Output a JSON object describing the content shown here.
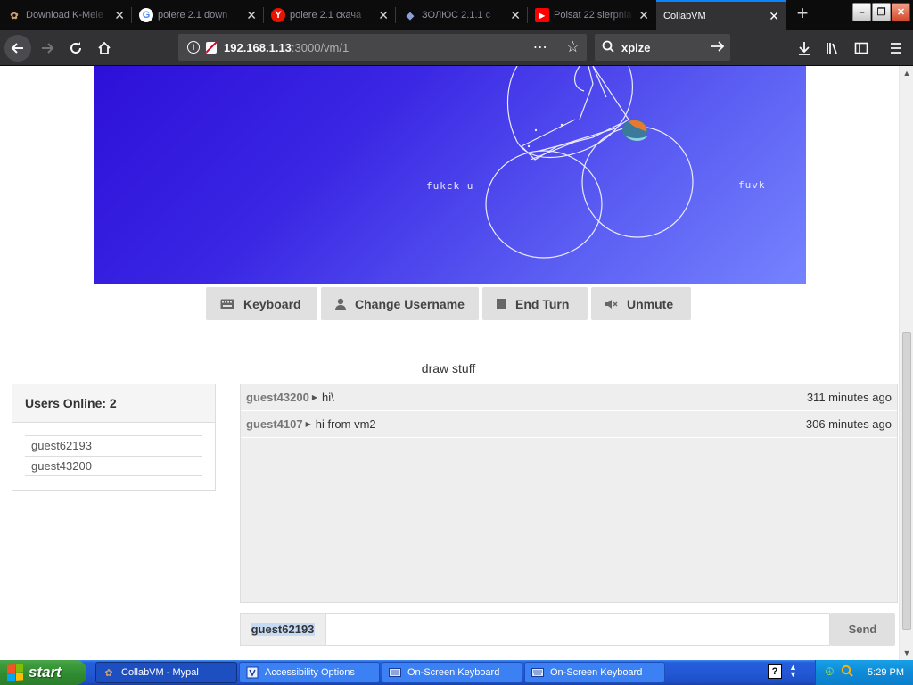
{
  "browser": {
    "tabs": [
      {
        "title": "Download K-Mele",
        "favicon": "kmeleon-icon"
      },
      {
        "title": "polere 2.1 down",
        "favicon": "google-icon"
      },
      {
        "title": "polere 2.1 скача",
        "favicon": "yandex-icon"
      },
      {
        "title": "ЗОЛЮС 2.1.1 с",
        "favicon": "diamond-site-icon"
      },
      {
        "title": "Polsat 22 sierpnia",
        "favicon": "youtube-icon"
      },
      {
        "title": "CollabVM",
        "favicon": "none",
        "active": true
      }
    ],
    "url_host": "192.168.1.13",
    "url_path": ":3000/vm/1",
    "search_text": "xpize",
    "colors": {
      "tab_accent": "#0a84ff",
      "toolbar": "#323234",
      "tabstrip": "#0c0c0d"
    }
  },
  "vm": {
    "screen_texts": [
      "fukck u",
      "fuvk"
    ],
    "buttons": {
      "keyboard": "Keyboard",
      "change_username": "Change Username",
      "end_turn": "End Turn",
      "unmute": "Unmute"
    },
    "motd": "draw stuff"
  },
  "users": {
    "header": "Users Online: 2",
    "list": [
      "guest62193",
      "guest43200"
    ]
  },
  "chat": {
    "messages": [
      {
        "user": "guest43200",
        "text": "hi\\",
        "time": "311 minutes ago"
      },
      {
        "user": "guest4107",
        "text": "hi from vm2",
        "time": "306 minutes ago"
      }
    ],
    "username": "guest62193",
    "input_value": "",
    "send_label": "Send"
  },
  "taskbar": {
    "start_label": "start",
    "tasks": [
      {
        "label": "CollabVM - Mypal",
        "icon": "mypal-icon",
        "active": true
      },
      {
        "label": "Accessibility Options",
        "icon": "accessibility-icon",
        "active": false
      },
      {
        "label": "On-Screen Keyboard",
        "icon": "keyboard-icon",
        "active": false
      },
      {
        "label": "On-Screen Keyboard",
        "icon": "keyboard-icon",
        "active": false
      }
    ],
    "clock": "5:29 PM",
    "colors": {
      "taskbar": "#245edb",
      "start": "#3c9b3c",
      "tray": "#0f8ad7"
    }
  }
}
